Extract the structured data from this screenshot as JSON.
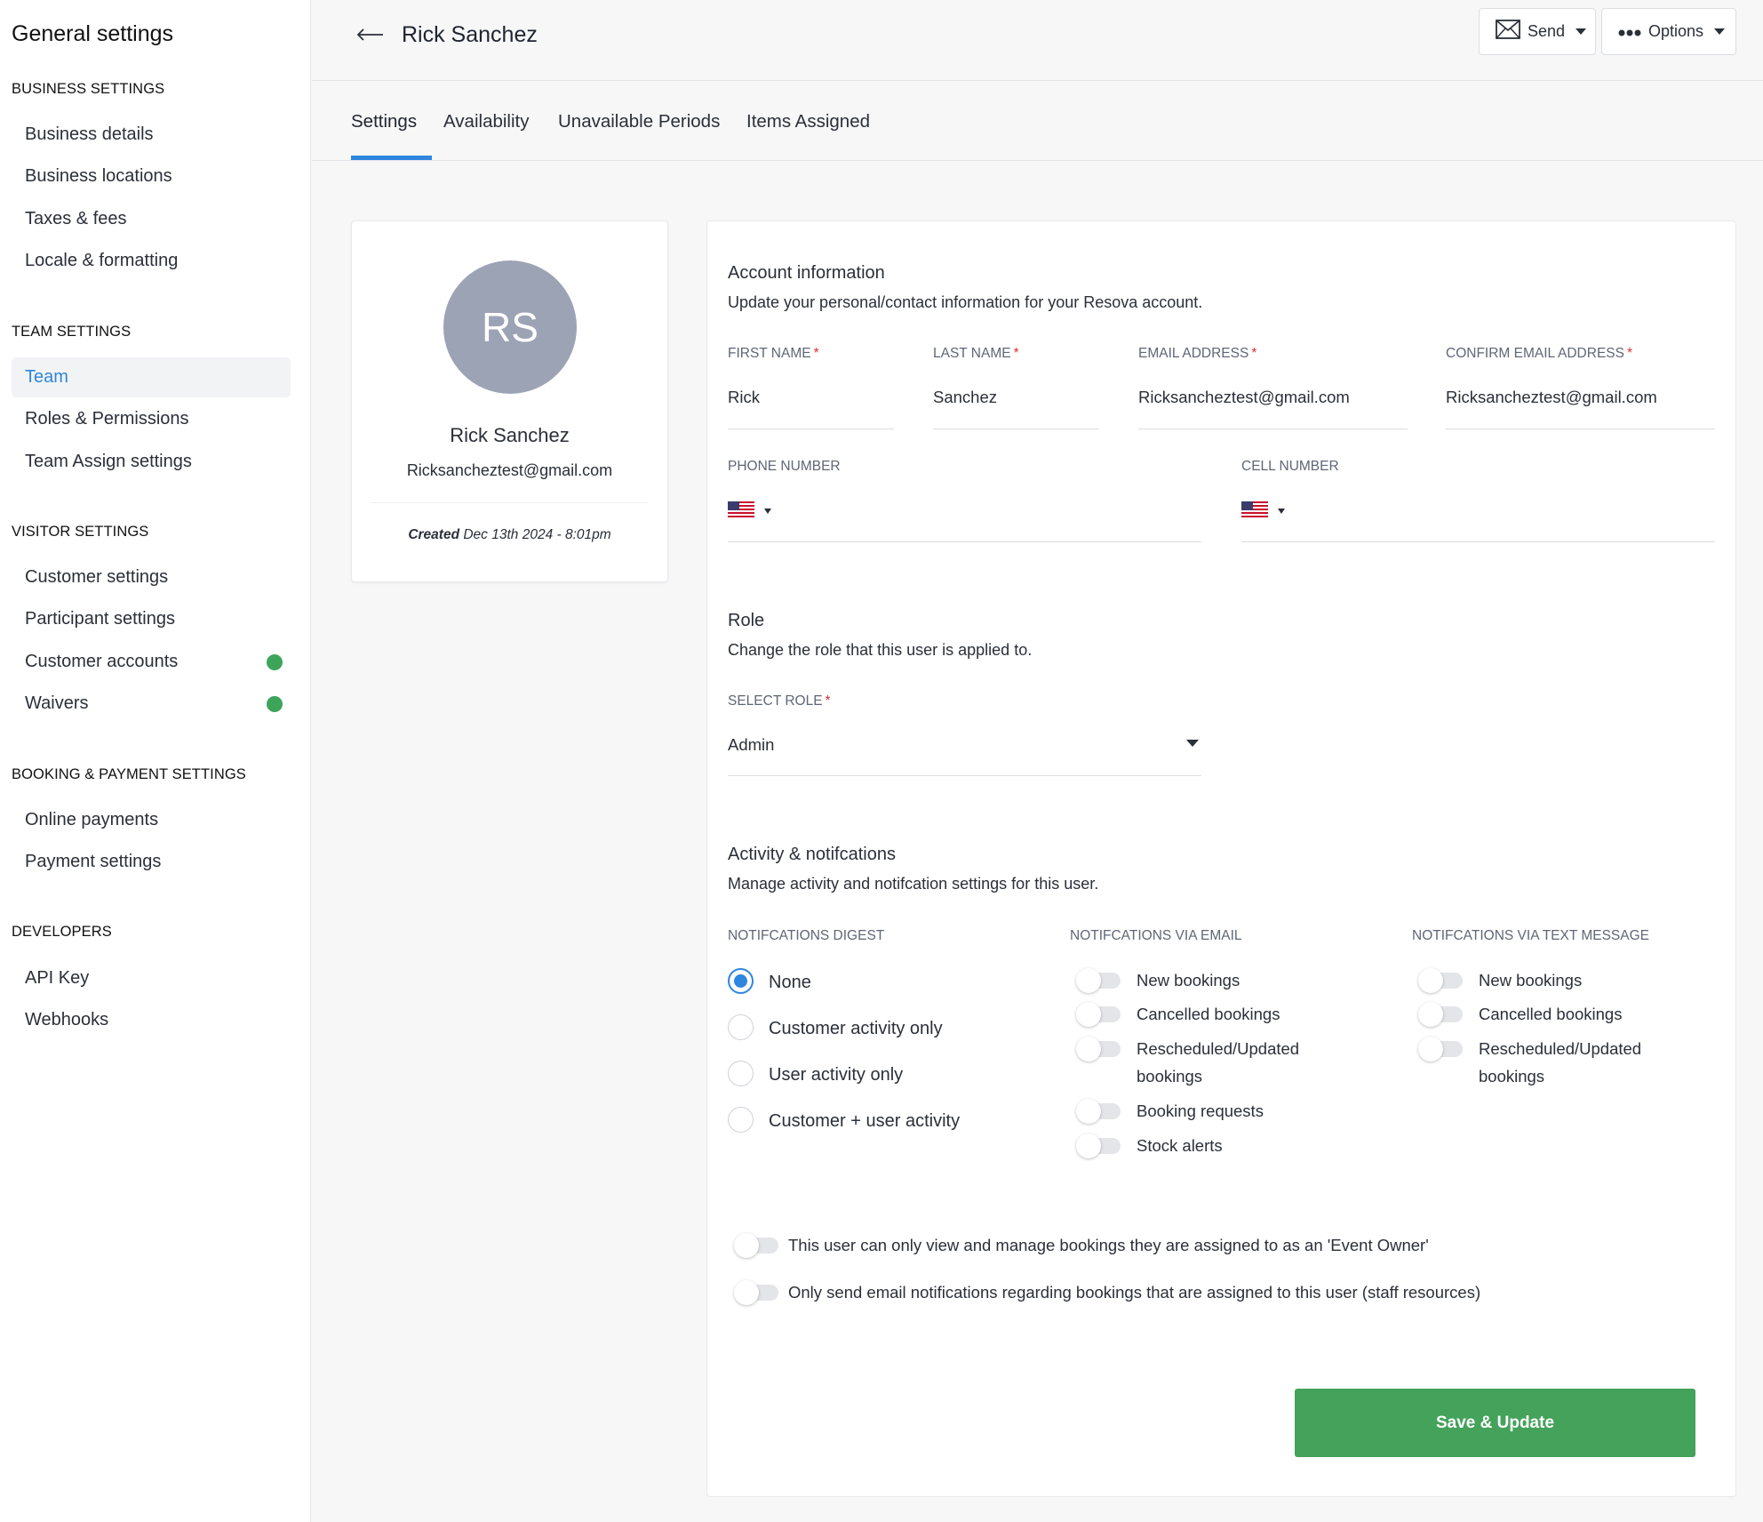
{
  "sidebar": {
    "title": "General settings",
    "sections": [
      {
        "label": "BUSINESS SETTINGS",
        "items": [
          "Business details",
          "Business locations",
          "Taxes & fees",
          "Locale & formatting"
        ]
      },
      {
        "label": "TEAM SETTINGS",
        "items": [
          "Team",
          "Roles & Permissions",
          "Team Assign settings"
        ]
      },
      {
        "label": "VISITOR SETTINGS",
        "items": [
          "Customer settings",
          "Participant settings",
          "Customer accounts",
          "Waivers"
        ]
      },
      {
        "label": "BOOKING & PAYMENT SETTINGS",
        "items": [
          "Online payments",
          "Payment settings"
        ]
      },
      {
        "label": "DEVELOPERS",
        "items": [
          "API Key",
          "Webhooks"
        ]
      }
    ],
    "active_item": "Team",
    "status_color": "#3da55a"
  },
  "header": {
    "title": "Rick Sanchez",
    "send_label": "Send",
    "options_label": "Options"
  },
  "tabs": [
    "Settings",
    "Availability",
    "Unavailable Periods",
    "Items Assigned"
  ],
  "active_tab": "Settings",
  "profile": {
    "initials": "RS",
    "name": "Rick Sanchez",
    "email": "Ricksancheztest@gmail.com",
    "created_label": "Created",
    "created_value": "Dec 13th 2024 - 8:01pm"
  },
  "account": {
    "title": "Account information",
    "subtitle": "Update your personal/contact information for your Resova account.",
    "first_name_label": "FIRST NAME",
    "first_name": "Rick",
    "last_name_label": "LAST NAME",
    "last_name": "Sanchez",
    "email_label": "EMAIL ADDRESS",
    "email": "Ricksancheztest@gmail.com",
    "confirm_email_label": "CONFIRM EMAIL ADDRESS",
    "confirm_email": "Ricksancheztest@gmail.com",
    "phone_label": "PHONE NUMBER",
    "cell_label": "CELL NUMBER"
  },
  "role": {
    "title": "Role",
    "subtitle": "Change the role that this user is applied to.",
    "select_label": "SELECT ROLE",
    "selected": "Admin"
  },
  "activity": {
    "title": "Activity & notifcations",
    "subtitle": "Manage activity and notifcation settings for this user.",
    "digest_label": "NOTIFCATIONS DIGEST",
    "digest_options": [
      "None",
      "Customer activity only",
      "User activity only",
      "Customer + user activity"
    ],
    "digest_selected": "None",
    "email_label": "NOTIFCATIONS VIA EMAIL",
    "email_toggles": [
      {
        "label": "New bookings",
        "on": false
      },
      {
        "label": "Cancelled bookings",
        "on": false
      },
      {
        "label": "Rescheduled/Updated",
        "label2": "bookings",
        "on": false
      },
      {
        "label": "Booking requests",
        "on": false
      },
      {
        "label": "Stock alerts",
        "on": false
      }
    ],
    "text_label": "NOTIFCATIONS VIA TEXT MESSAGE",
    "text_toggles": [
      {
        "label": "New bookings",
        "on": false
      },
      {
        "label": "Cancelled bookings",
        "on": false
      },
      {
        "label": "Rescheduled/Updated",
        "label2": "bookings",
        "on": false
      }
    ],
    "event_owner_toggle": "This user can only view and manage bookings they are assigned to as an 'Event Owner'",
    "staff_resources_toggle": "Only send email notifications regarding bookings that are assigned to this user (staff resources)"
  },
  "save_label": "Save & Update",
  "colors": {
    "accent": "#2e86de",
    "save": "#44a25b",
    "required": "#e03030"
  }
}
